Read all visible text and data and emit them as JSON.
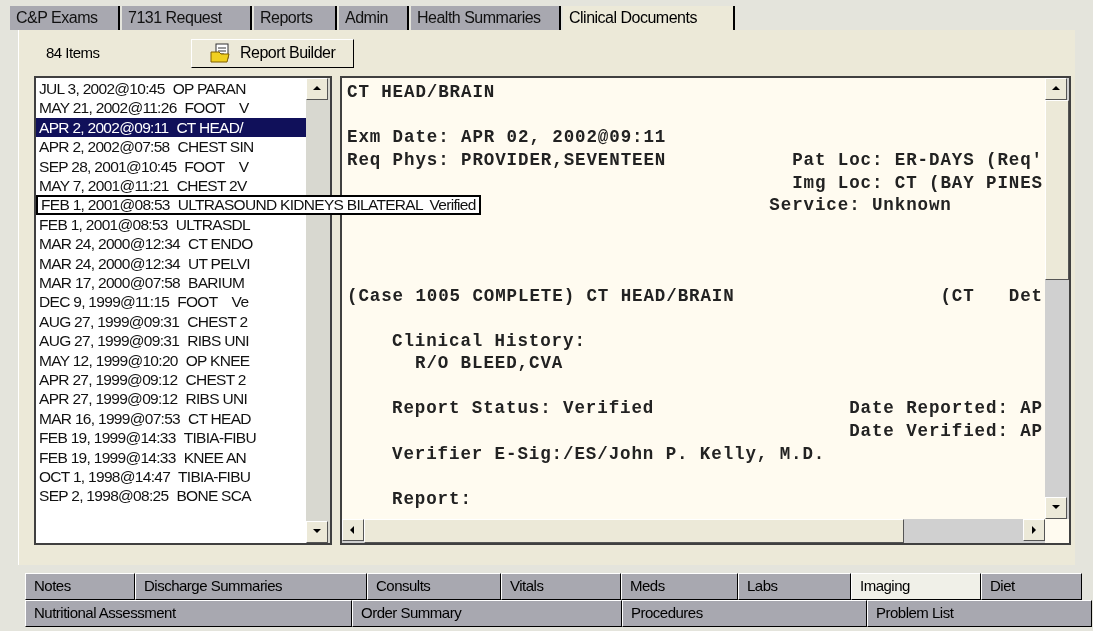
{
  "top_tabs": [
    {
      "label": "C&P Exams",
      "selected": false
    },
    {
      "label": "7131 Request",
      "selected": false
    },
    {
      "label": "Reports",
      "selected": false
    },
    {
      "label": "Admin",
      "selected": false
    },
    {
      "label": "Health Summaries",
      "selected": false
    },
    {
      "label": "Clinical Documents",
      "selected": true
    }
  ],
  "item_count": "84 Items",
  "report_builder_button": "Report Builder",
  "documents": [
    {
      "date": "JUL 3, 2002@10:45",
      "title": "OP PARAN",
      "selected": false,
      "hinted": false
    },
    {
      "date": "MAY 21, 2002@11:26",
      "title": "FOOT    V",
      "selected": false,
      "hinted": false
    },
    {
      "date": "APR 2, 2002@09:11",
      "title": "CT HEAD/",
      "selected": true,
      "hinted": false
    },
    {
      "date": "APR 2, 2002@07:58",
      "title": "CHEST SIN",
      "selected": false,
      "hinted": false
    },
    {
      "date": "SEP 28, 2001@10:45",
      "title": "FOOT    V",
      "selected": false,
      "hinted": false
    },
    {
      "date": "MAY 7, 2001@11:21",
      "title": "CHEST 2V",
      "selected": false,
      "hinted": false
    },
    {
      "date": "FEB 1, 2001@08:53",
      "title": "ULTRASOUND KIDNEYS BILATERAL  Verified",
      "selected": false,
      "hinted": true
    },
    {
      "date": "FEB 1, 2001@08:53",
      "title": "ULTRASDL",
      "selected": false,
      "hinted": false
    },
    {
      "date": "MAR 24, 2000@12:34",
      "title": "CT ENDO",
      "selected": false,
      "hinted": false
    },
    {
      "date": "MAR 24, 2000@12:34",
      "title": "UT PELVI",
      "selected": false,
      "hinted": false
    },
    {
      "date": "MAR 17, 2000@07:58",
      "title": "BARIUM",
      "selected": false,
      "hinted": false
    },
    {
      "date": "DEC 9, 1999@11:15",
      "title": "FOOT    Ve",
      "selected": false,
      "hinted": false
    },
    {
      "date": "AUG 27, 1999@09:31",
      "title": "CHEST 2",
      "selected": false,
      "hinted": false
    },
    {
      "date": "AUG 27, 1999@09:31",
      "title": "RIBS UNI",
      "selected": false,
      "hinted": false
    },
    {
      "date": "MAY 12, 1999@10:20",
      "title": "OP KNEE",
      "selected": false,
      "hinted": false
    },
    {
      "date": "APR 27, 1999@09:12",
      "title": "CHEST 2",
      "selected": false,
      "hinted": false
    },
    {
      "date": "APR 27, 1999@09:12",
      "title": "RIBS UNI",
      "selected": false,
      "hinted": false
    },
    {
      "date": "MAR 16, 1999@07:53",
      "title": "CT HEAD",
      "selected": false,
      "hinted": false
    },
    {
      "date": "FEB 19, 1999@14:33",
      "title": "TIBIA-FIBU",
      "selected": false,
      "hinted": false
    },
    {
      "date": "FEB 19, 1999@14:33",
      "title": "KNEE AN",
      "selected": false,
      "hinted": false
    },
    {
      "date": "OCT 1, 1998@14:47",
      "title": "TIBIA-FIBU",
      "selected": false,
      "hinted": false
    },
    {
      "date": "SEP 2, 1998@08:25",
      "title": "BONE SCA",
      "selected": false,
      "hinted": false
    }
  ],
  "report_lines": [
    {
      "kind": "plain",
      "left": "CT HEAD/BRAIN"
    },
    {
      "kind": "blank"
    },
    {
      "kind": "plain",
      "left": "Exm Date: APR 02, 2002@09:11"
    },
    {
      "kind": "plain",
      "left": "Req Phys: PROVIDER,SEVENTEEN",
      "right": "Pat Loc: ER-DAYS (Req'"
    },
    {
      "kind": "plain",
      "right": "Img Loc: CT (BAY PINES"
    },
    {
      "kind": "plain",
      "right": "Service: Unknown        "
    },
    {
      "kind": "blank"
    },
    {
      "kind": "blank"
    },
    {
      "kind": "blank"
    },
    {
      "kind": "plain",
      "left": "(Case 1005 COMPLETE) CT HEAD/BRAIN",
      "right": "(CT   Det"
    },
    {
      "kind": "blank"
    },
    {
      "kind": "section",
      "left": "Clinical History:"
    },
    {
      "kind": "detail",
      "left": "R/O BLEED,CVA"
    },
    {
      "kind": "blank"
    },
    {
      "kind": "section",
      "left": "Report Status: Verified",
      "right": "Date Reported: AP"
    },
    {
      "kind": "section",
      "right": "Date Verified: AP"
    },
    {
      "kind": "section",
      "left": "Verifier E-Sig:/ES/John P. Kelly, M.D."
    },
    {
      "kind": "blank"
    },
    {
      "kind": "section",
      "left": "Report:"
    }
  ],
  "bottom_tabs": [
    [
      {
        "label": "Notes",
        "selected": false
      },
      {
        "label": "Discharge Summaries",
        "selected": false
      },
      {
        "label": "Consults",
        "selected": false
      },
      {
        "label": "Vitals",
        "selected": false
      },
      {
        "label": "Meds",
        "selected": false
      },
      {
        "label": "Labs",
        "selected": false
      },
      {
        "label": "Imaging",
        "selected": true
      },
      {
        "label": "Diet",
        "selected": false
      }
    ],
    [
      {
        "label": "Nutritional Assessment",
        "selected": false
      },
      {
        "label": "Order Summary",
        "selected": false
      },
      {
        "label": "Procedures",
        "selected": false
      },
      {
        "label": "Problem List",
        "selected": false
      }
    ]
  ]
}
